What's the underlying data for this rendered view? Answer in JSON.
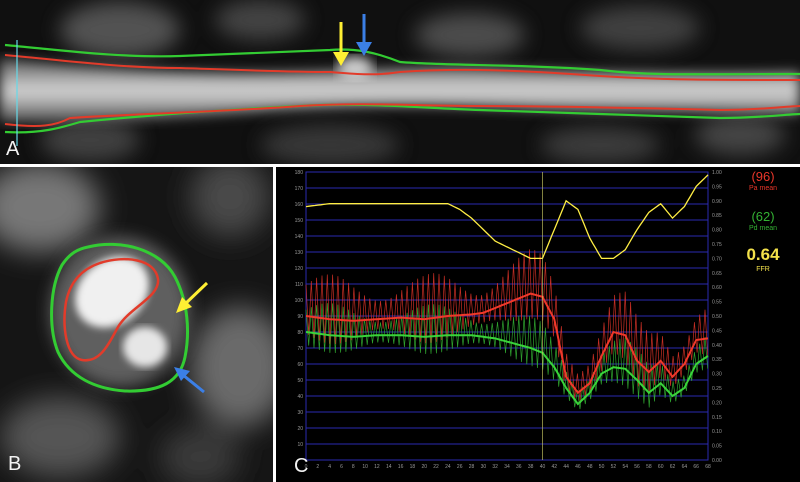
{
  "panels": {
    "a": {
      "label": "A"
    },
    "b": {
      "label": "B"
    },
    "c": {
      "label": "C"
    }
  },
  "colors": {
    "outer_contour": "#33cc33",
    "inner_contour": "#e23b2a",
    "yellow_arrow": "#ffef33",
    "blue_arrow": "#3b7fe6",
    "pa_trace": "#e8362a",
    "pd_trace": "#33b233",
    "ffr_trace": "#ffee44",
    "grid": "#2a2ab0"
  },
  "readout": {
    "pa_value": "(96)",
    "pa_label": "Pa mean",
    "pd_value": "(62)",
    "pd_label": "Pd mean",
    "ffr_value": "0.64",
    "ffr_label": "FFR"
  },
  "chart_data": {
    "type": "line",
    "title": "",
    "xlabel": "",
    "ylabel": "",
    "x_ticks": [
      "0",
      "2",
      "4",
      "6",
      "8",
      "10",
      "12",
      "14",
      "16",
      "18",
      "20",
      "22",
      "24",
      "26",
      "28",
      "30",
      "32",
      "34",
      "36",
      "38",
      "40",
      "42",
      "44",
      "46",
      "48",
      "50",
      "52",
      "54",
      "56",
      "58",
      "60",
      "62",
      "64",
      "66",
      "68"
    ],
    "y_ticks_left": [
      "10",
      "20",
      "30",
      "40",
      "50",
      "60",
      "70",
      "80",
      "90",
      "100",
      "110",
      "120",
      "130",
      "140",
      "150",
      "160",
      "170",
      "180"
    ],
    "y_ticks_right": [
      "0.00",
      "0.05",
      "0.10",
      "0.15",
      "0.20",
      "0.25",
      "0.30",
      "0.35",
      "0.40",
      "0.45",
      "0.50",
      "0.55",
      "0.60",
      "0.65",
      "0.70",
      "0.75",
      "0.80",
      "0.85",
      "0.90",
      "0.95",
      "1.00"
    ],
    "xlim": [
      0,
      68
    ],
    "ylim_left": [
      0,
      180
    ],
    "ylim_right": [
      0,
      1.0
    ],
    "grid": true,
    "marker_x": 40,
    "series": [
      {
        "key": "ffr",
        "axis": "right",
        "x": [
          0,
          4,
          8,
          12,
          16,
          20,
          24,
          26,
          28,
          30,
          32,
          34,
          36,
          38,
          40,
          42,
          44,
          46,
          48,
          50,
          52,
          54,
          56,
          58,
          60,
          62,
          64,
          66,
          68
        ],
        "values": [
          0.88,
          0.89,
          0.89,
          0.89,
          0.89,
          0.89,
          0.89,
          0.87,
          0.84,
          0.8,
          0.76,
          0.74,
          0.72,
          0.7,
          0.7,
          0.8,
          0.9,
          0.87,
          0.77,
          0.7,
          0.7,
          0.73,
          0.8,
          0.86,
          0.89,
          0.84,
          0.88,
          0.95,
          0.99
        ]
      },
      {
        "key": "pa_mean",
        "axis": "left",
        "x": [
          0,
          4,
          8,
          12,
          16,
          20,
          24,
          28,
          30,
          32,
          34,
          36,
          38,
          40,
          42,
          44,
          46,
          48,
          50,
          52,
          54,
          56,
          58,
          60,
          62,
          64,
          66,
          68
        ],
        "values": [
          90,
          88,
          87,
          88,
          89,
          88,
          90,
          91,
          92,
          95,
          98,
          101,
          104,
          102,
          88,
          52,
          42,
          48,
          65,
          80,
          78,
          62,
          55,
          62,
          52,
          60,
          75,
          76
        ]
      },
      {
        "key": "pd_mean",
        "axis": "left",
        "x": [
          0,
          4,
          8,
          12,
          16,
          20,
          24,
          28,
          30,
          32,
          34,
          36,
          38,
          40,
          42,
          44,
          46,
          48,
          50,
          52,
          54,
          56,
          58,
          60,
          62,
          64,
          66,
          68
        ],
        "values": [
          80,
          78,
          77,
          78,
          78,
          77,
          78,
          78,
          77,
          76,
          74,
          72,
          70,
          67,
          58,
          45,
          35,
          42,
          54,
          58,
          57,
          50,
          42,
          48,
          40,
          45,
          60,
          65
        ]
      }
    ]
  }
}
